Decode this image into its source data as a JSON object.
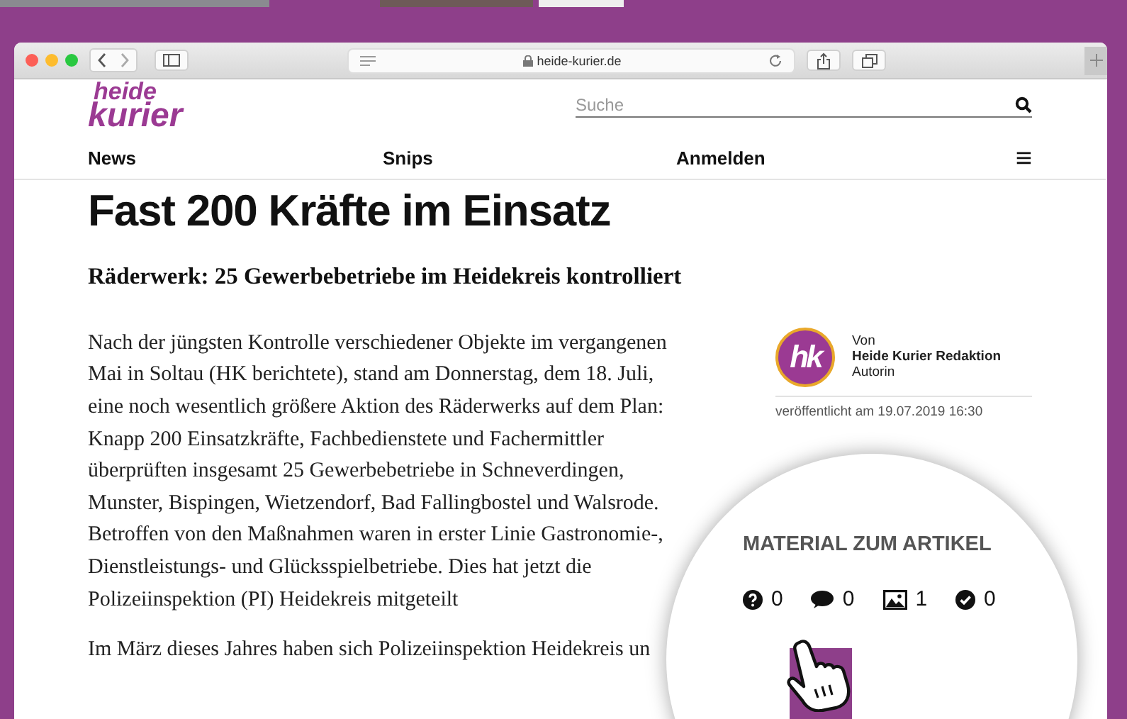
{
  "browser": {
    "url": "heide-kurier.de"
  },
  "site": {
    "logo_top": "heide",
    "logo_bottom": "kurier",
    "search": {
      "placeholder": "Suche"
    },
    "nav": [
      {
        "label": "News"
      },
      {
        "label": "Snips"
      },
      {
        "label": "Anmelden"
      }
    ],
    "menu_glyph": "≡"
  },
  "article": {
    "headline": "Fast 200 Kräfte im Einsatz",
    "subtitle": "Räderwerk: 25 Gewerbebetriebe im Heidekreis kontrolliert",
    "paragraphs": [
      "Nach der jüngsten Kontrolle verschiedener Objekte im vergangenen Mai in Soltau (HK berichtete), stand am Donnerstag, dem 18. Juli, eine noch wesentlich größere Aktion des Räderwerks auf dem Plan: Knapp 200 Einsatzkräfte, Fachbedienstete und Fachermittler überprüften insgesamt 25 Gewerbebetriebe in Schneverdingen, Munster, Bispingen, Wietzendorf, Bad Fallingbostel und Walsrode. Betroffen von den Maßnahmen waren in erster Linie Gastronomie-, Dienstleistungs- und Glücksspielbetriebe. Dies hat jetzt die Polizeiinspektion (PI) Heidekreis mitgeteilt",
      "Im März dieses Jahres haben sich Polizeiinspektion Heidekreis un"
    ]
  },
  "author": {
    "avatar_text": "hk",
    "prefix": "Von",
    "name": "Heide Kurier Redaktion",
    "role": "Autorin",
    "published": "veröffentlicht am 19.07.2019 16:30"
  },
  "material": {
    "title": "MATERIAL ZUM ARTIKEL",
    "stats": [
      {
        "kind": "question",
        "count": "0"
      },
      {
        "kind": "comment",
        "count": "0"
      },
      {
        "kind": "image",
        "count": "1"
      },
      {
        "kind": "check",
        "count": "0"
      }
    ]
  }
}
